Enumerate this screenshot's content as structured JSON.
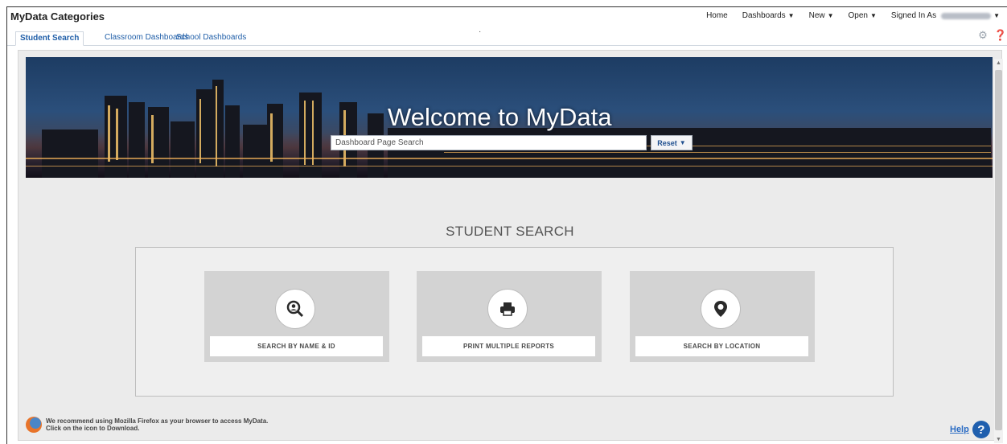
{
  "app": {
    "title": "MyData Categories"
  },
  "menu": {
    "home": "Home",
    "dashboards": "Dashboards",
    "new": "New",
    "open": "Open",
    "signed_in_as": "Signed In As"
  },
  "tabs": [
    {
      "label": "Student Search",
      "active": true
    },
    {
      "label": "Classroom Dashboards",
      "active": false
    },
    {
      "label": "School Dashboards",
      "active": false
    }
  ],
  "icons": {
    "settings": "gear-icon",
    "help_small": "question-circle-icon",
    "caret": "caret-down-icon",
    "firefox": "firefox-logo-icon"
  },
  "banner": {
    "welcome": "Welcome to MyData",
    "search_placeholder": "Dashboard Page Search",
    "reset_label": "Reset"
  },
  "student_search": {
    "title": "STUDENT SEARCH",
    "cards": [
      {
        "label": "SEARCH BY NAME & ID",
        "icon": "magnifier-person-icon"
      },
      {
        "label": "PRINT MULTIPLE REPORTS",
        "icon": "printer-icon"
      },
      {
        "label": "SEARCH BY LOCATION",
        "icon": "map-pin-icon"
      }
    ]
  },
  "footer": {
    "recommend_line1": "We recommend using Mozilla Firefox as your browser to access MyData.",
    "recommend_line2": "Click on the icon to Download.",
    "help_label": "Help"
  },
  "colors": {
    "link": "#1f5ea8",
    "help_icon": "#1f5fae",
    "card_bg": "#d3d3d3",
    "content_bg": "#ebebeb"
  }
}
